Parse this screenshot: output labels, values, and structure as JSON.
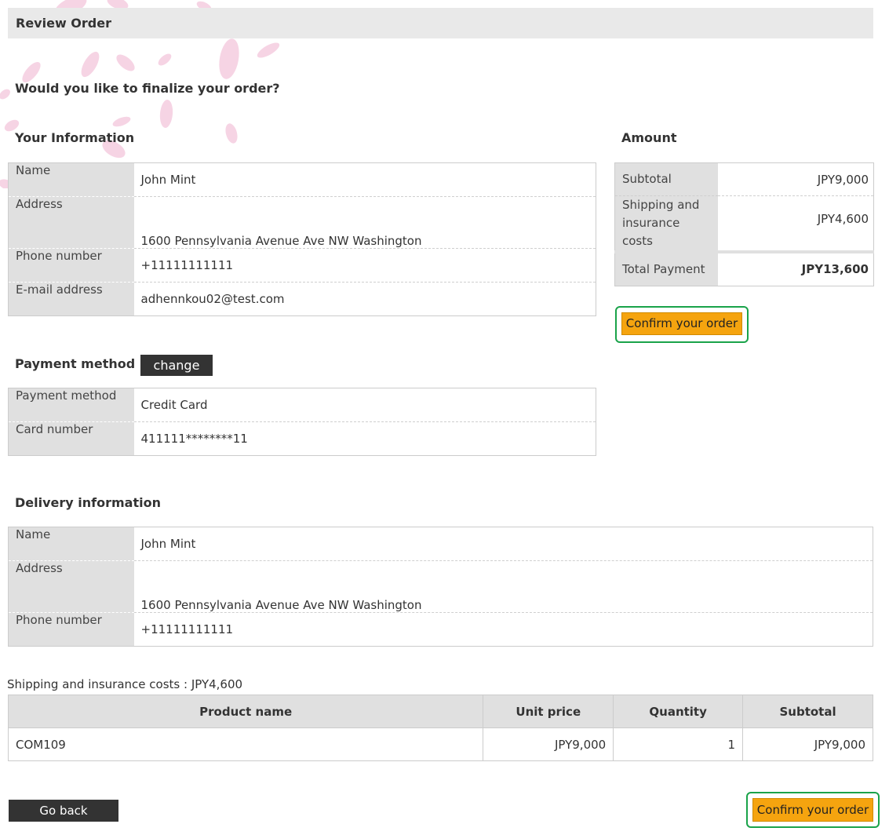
{
  "header": {
    "title": "Review Order"
  },
  "question": "Would you like to finalize your order?",
  "your_information": {
    "title": "Your Information",
    "rows": [
      {
        "label": "Name",
        "value": "John Mint"
      },
      {
        "label": "Address",
        "value": "1600 Pennsylvania Avenue Ave NW Washington"
      },
      {
        "label": "Phone number",
        "value": "+11111111111"
      },
      {
        "label": "E-mail address",
        "value": "adhennkou02@test.com"
      }
    ]
  },
  "amount": {
    "title": "Amount",
    "subtotal_label": "Subtotal",
    "subtotal_value": "JPY9,000",
    "shipping_label_line1": "Shipping and",
    "shipping_label_line2": "insurance costs",
    "shipping_value": "JPY4,600",
    "total_label": "Total Payment",
    "total_value": "JPY13,600",
    "confirm_label": "Confirm your order"
  },
  "payment": {
    "title": "Payment method",
    "change_label": "change",
    "rows": [
      {
        "label": "Payment method",
        "value": "Credit Card"
      },
      {
        "label": "Card number",
        "value": "411111********11"
      }
    ]
  },
  "delivery": {
    "title": "Delivery information",
    "rows": [
      {
        "label": "Name",
        "value": "John Mint"
      },
      {
        "label": "Address",
        "value": "1600 Pennsylvania Avenue Ave NW Washington"
      },
      {
        "label": "Phone number",
        "value": "+11111111111"
      }
    ]
  },
  "shipping_note": "Shipping and insurance costs :  JPY4,600",
  "products": {
    "headers": [
      "Product name",
      "Unit price",
      "Quantity",
      "Subtotal"
    ],
    "rows": [
      {
        "name": "COM109",
        "unit_price": "JPY9,000",
        "quantity": "1",
        "subtotal": "JPY9,000"
      }
    ]
  },
  "footer": {
    "go_back_label": "Go back",
    "confirm_label": "Confirm your order"
  },
  "colors": {
    "confirm_button": "#f5a40f",
    "highlight_border": "#1aa34a",
    "dark_button": "#333333",
    "label_cell": "#e0e0e0"
  }
}
